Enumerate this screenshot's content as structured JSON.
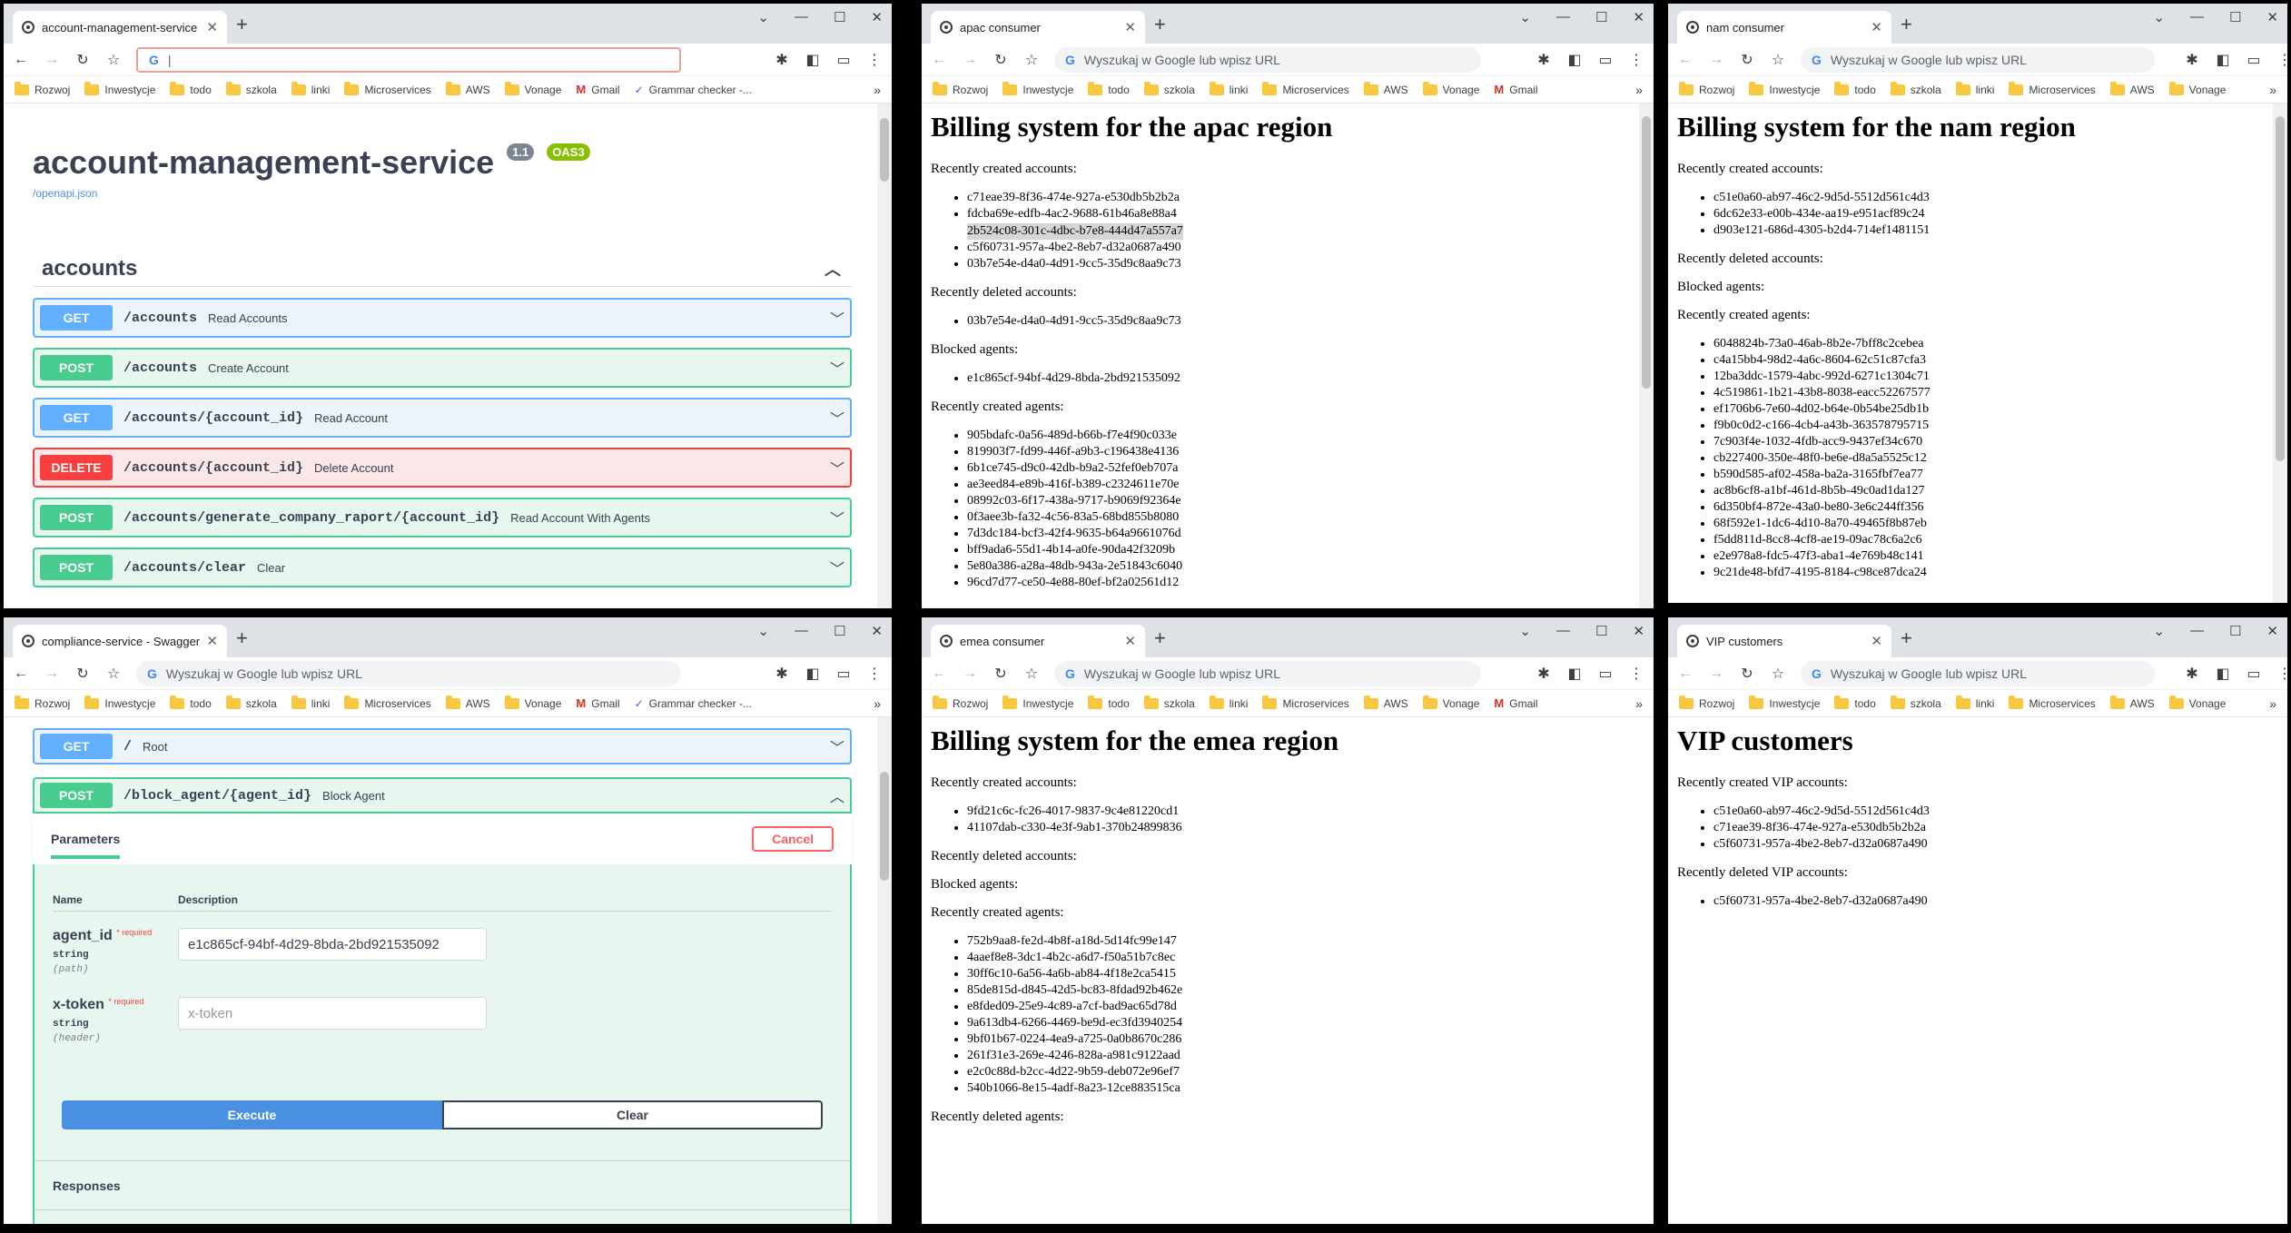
{
  "bookmarks": {
    "full": [
      "Rozwoj",
      "Inwestycje",
      "todo",
      "szkola",
      "linki",
      "Microservices",
      "AWS",
      "Vonage",
      "Gmail",
      "Grammar checker -..."
    ],
    "medium": [
      "Rozwoj",
      "Inwestycje",
      "todo",
      "szkola",
      "linki",
      "Microservices",
      "AWS",
      "Vonage",
      "Gmail"
    ],
    "short": [
      "Rozwoj",
      "Inwestycje",
      "todo",
      "szkola",
      "linki",
      "Microservices",
      "AWS",
      "Vonage"
    ]
  },
  "omnibox_placeholder": "Wyszukaj w Google lub wpisz URL",
  "w1": {
    "tab_title": "account-management-service - S",
    "title": "account-management-service",
    "version": "1.1",
    "oas": "OAS3",
    "link": "/openapi.json",
    "section": "accounts",
    "ops": [
      {
        "method": "GET",
        "path": "/accounts",
        "summary": "Read Accounts"
      },
      {
        "method": "POST",
        "path": "/accounts",
        "summary": "Create Account"
      },
      {
        "method": "GET",
        "path": "/accounts/{account_id}",
        "summary": "Read Account"
      },
      {
        "method": "DELETE",
        "path": "/accounts/{account_id}",
        "summary": "Delete Account"
      },
      {
        "method": "POST",
        "path": "/accounts/generate_company_raport/{account_id}",
        "summary": "Read Account With Agents"
      },
      {
        "method": "POST",
        "path": "/accounts/clear",
        "summary": "Clear"
      }
    ]
  },
  "w2": {
    "tab_title": "apac consumer",
    "heading": "Billing system for the apac region",
    "l1": "Recently created accounts:",
    "created_accounts": [
      "c71eae39-8f36-474e-927a-e530db5b2b2a",
      "fdcba69e-edfb-4ac2-9688-61b46a8e88a4",
      "2b524c08-301c-4dbc-b7e8-444d47a557a7",
      "c5f60731-957a-4be2-8eb7-d32a0687a490",
      "03b7e54e-d4a0-4d91-9cc5-35d9c8aa9c73"
    ],
    "l2": "Recently deleted accounts:",
    "deleted_accounts": [
      "03b7e54e-d4a0-4d91-9cc5-35d9c8aa9c73"
    ],
    "l3": "Blocked agents:",
    "blocked_agents": [
      "e1c865cf-94bf-4d29-8bda-2bd921535092"
    ],
    "l4": "Recently created agents:",
    "created_agents": [
      "905bdafc-0a56-489d-b66b-f7e4f90c033e",
      "819903f7-fd99-446f-a9b3-c196438e4136",
      "6b1ce745-d9c0-42db-b9a2-52fef0eb707a",
      "ae3eed84-e89b-416f-b389-c2324611e70e",
      "08992c03-6f17-438a-9717-b9069f92364e",
      "0f3aee3b-fa32-4c56-83a5-68bd855b8080",
      "7d3dc184-bcf3-42f4-9635-b64a9661076d",
      "bff9ada6-55d1-4b14-a0fe-90da42f3209b",
      "5e80a386-a28a-48db-943a-2e51843c6040",
      "96cd7d77-ce50-4e88-80ef-bf2a02561d12"
    ]
  },
  "w3": {
    "tab_title": "nam consumer",
    "heading": "Billing system for the nam region",
    "l1": "Recently created accounts:",
    "created_accounts": [
      "c51e0a60-ab97-46c2-9d5d-5512d561c4d3",
      "6dc62e33-e00b-434e-aa19-e951acf89c24",
      "d903e121-686d-4305-b2d4-714ef1481151"
    ],
    "l2": "Recently deleted accounts:",
    "l3": "Blocked agents:",
    "l4": "Recently created agents:",
    "created_agents": [
      "6048824b-73a0-46ab-8b2e-7bff8c2cebea",
      "c4a15bb4-98d2-4a6c-8604-62c51c87cfa3",
      "12ba3ddc-1579-4abc-992d-6271c1304c71",
      "4c519861-1b21-43b8-8038-eacc52267577",
      "ef1706b6-7e60-4d02-b64e-0b54be25db1b",
      "f9b0c0d2-c166-4cb4-a43b-363578795715",
      "7c903f4e-1032-4fdb-acc9-9437ef34c670",
      "cb227400-350e-48f0-be6e-d8a5a5525c12",
      "b590d585-af02-458a-ba2a-3165fbf7ea77",
      "ac8b6cf8-a1bf-461d-8b5b-49c0ad1da127",
      "6d350bf4-872e-43a0-be80-3e6c244ff356",
      "68f592e1-1dc6-4d10-8a70-49465f8b87eb",
      "f5dd811d-8cc8-4cf8-ae19-09ac78c6a2c6",
      "e2e978a8-fdc5-47f3-aba1-4e769b48c141",
      "9c21de48-bfd7-4195-8184-c98ce87dca24"
    ]
  },
  "w4": {
    "tab_title": "compliance-service - Swagger UI",
    "op1": {
      "method": "GET",
      "path": "/",
      "summary": "Root"
    },
    "op2": {
      "method": "POST",
      "path": "/block_agent/{agent_id}",
      "summary": "Block Agent"
    },
    "parameters_tab": "Parameters",
    "cancel": "Cancel",
    "col_name": "Name",
    "col_desc": "Description",
    "required_mark": "* required",
    "p1": {
      "name": "agent_id",
      "type": "string",
      "in": "(path)",
      "value": "e1c865cf-94bf-4d29-8bda-2bd921535092"
    },
    "p2": {
      "name": "x-token",
      "type": "string",
      "in": "(header)",
      "placeholder": "x-token"
    },
    "execute": "Execute",
    "clear": "Clear",
    "responses": "Responses"
  },
  "w5": {
    "tab_title": "emea consumer",
    "heading": "Billing system for the emea region",
    "l1": "Recently created accounts:",
    "created_accounts": [
      "9fd21c6c-fc26-4017-9837-9c4e81220cd1",
      "41107dab-c330-4e3f-9ab1-370b24899836"
    ],
    "l2": "Recently deleted accounts:",
    "l3": "Blocked agents:",
    "l4": "Recently created agents:",
    "created_agents": [
      "752b9aa8-fe2d-4b8f-a18d-5d14fc99e147",
      "4aaef8e8-3dc1-4b2c-a6d7-f50a51b7c8ec",
      "30ff6c10-6a56-4a6b-ab84-4f18e2ca5415",
      "85de815d-d845-42d5-bc83-8fdad92b462e",
      "e8fded09-25e9-4c89-a7cf-bad9ac65d78d",
      "9a613db4-6266-4469-be9d-ec3fd3940254",
      "9bf01b67-0224-4ea9-a725-0a0b8670c286",
      "261f31e3-269e-4246-828a-a981c9122aad",
      "e2c0c88d-b2cc-4d22-9b59-deb072e96ef7",
      "540b1066-8e15-4adf-8a23-12ce883515ca"
    ],
    "l5": "Recently deleted agents:"
  },
  "w6": {
    "tab_title": "VIP customers",
    "heading": "VIP customers",
    "l1": "Recently created VIP accounts:",
    "created": [
      "c51e0a60-ab97-46c2-9d5d-5512d561c4d3",
      "c71eae39-8f36-474e-927a-e530db5b2b2a",
      "c5f60731-957a-4be2-8eb7-d32a0687a490"
    ],
    "l2": "Recently deleted VIP accounts:",
    "deleted": [
      "c5f60731-957a-4be2-8eb7-d32a0687a490"
    ]
  }
}
